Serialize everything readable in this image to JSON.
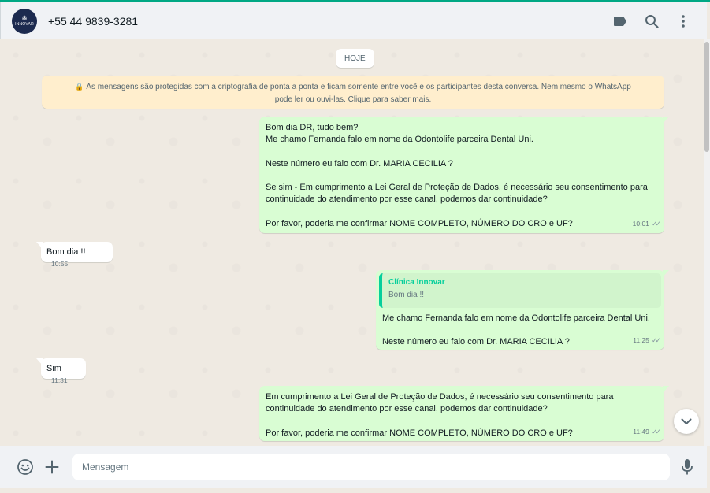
{
  "header": {
    "avatar_brand": "INNOVAR",
    "contact": "+55 44 9839-3281"
  },
  "chat": {
    "day_label": "HOJE",
    "encryption_notice": "As mensagens são protegidas com a criptografia de ponta a ponta e ficam somente entre você e os participantes desta conversa. Nem mesmo o WhatsApp pode ler ou ouvi-las. Clique para saber mais.",
    "messages": [
      {
        "direction": "out",
        "text": "Bom dia DR, tudo bem?\nMe chamo Fernanda falo em nome da Odontolife parceira Dental Uni.\n\nNeste número eu falo com Dr. MARIA CECILIA ?\n\nSe sim - Em cumprimento a Lei Geral de Proteção de Dados, é necessário seu consentimento para continuidade do atendimento por esse canal, podemos dar continuidade?\n\nPor favor, poderia me confirmar NOME COMPLETO, NÚMERO DO CRO e UF?",
        "time": "10:01"
      },
      {
        "direction": "in",
        "text": "Bom dia !!",
        "time": "10:55"
      },
      {
        "direction": "out",
        "quote_author": "Clínica Innovar",
        "quote_text": "Bom dia !!",
        "text": "Me chamo Fernanda falo em nome da Odontolife parceira Dental Uni.\n\nNeste número eu falo com Dr. MARIA CECILIA ?",
        "time": "11:25"
      },
      {
        "direction": "in",
        "text": "Sim",
        "time": "11:31"
      },
      {
        "direction": "out",
        "text": "Em cumprimento a Lei Geral de Proteção de Dados, é necessário seu consentimento para continuidade do atendimento por esse canal, podemos dar continuidade?\n\nPor favor, poderia me confirmar NOME COMPLETO, NÚMERO DO CRO e UF?",
        "time": "11:49"
      }
    ]
  },
  "footer": {
    "input_placeholder": "Mensagem"
  },
  "colors": {
    "accent": "#00a884",
    "outgoing_bubble": "#d9fdd3",
    "incoming_bubble": "#ffffff",
    "notice_bg": "#ffeecd",
    "quote_author": "#06cf9c"
  },
  "icons": {
    "header": [
      "label-icon",
      "search-icon",
      "menu-dots-icon"
    ],
    "footer": [
      "emoji-icon",
      "plus-icon",
      "microphone-icon"
    ]
  }
}
